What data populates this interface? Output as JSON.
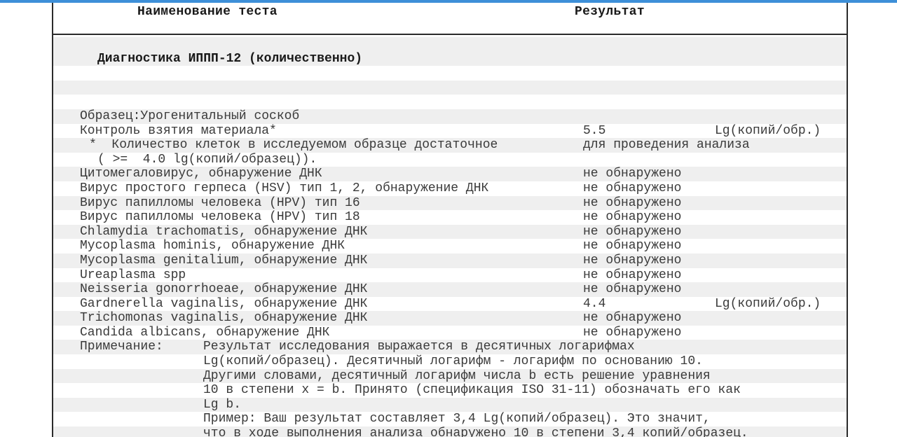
{
  "header": {
    "test_name": "Наименование теста",
    "result": "Результат"
  },
  "section_title": "Диагностика ИППП-12 (количественно)",
  "sample": "Образец:Урогенитальный соскоб",
  "control": {
    "name": "Контроль взятия материала*",
    "value": "5.5",
    "unit": "Lg(копий/обр.)"
  },
  "footnote": {
    "line1": "*  Количество клеток в исследуемом образце достаточное",
    "line1_right": "для проведения анализа",
    "line2": "( >=  4.0 lg(копий/образец))."
  },
  "tests": [
    {
      "name": "Цитомегаловирус, обнаружение ДНК",
      "result": "не обнаружено",
      "unit": ""
    },
    {
      "name": "Вирус простого герпеса (HSV) тип 1, 2, обнаружение ДНК",
      "result": "не обнаружено",
      "unit": ""
    },
    {
      "name": "Вирус папилломы человека (HPV) тип 16",
      "result": "не обнаружено",
      "unit": ""
    },
    {
      "name": "Вирус папилломы человека (HPV) тип 18",
      "result": "не обнаружено",
      "unit": ""
    },
    {
      "name": "Chlamydia trachomatis, обнаружение ДНК",
      "result": "не обнаружено",
      "unit": ""
    },
    {
      "name": "Mycoplasma hominis, обнаружение ДНК",
      "result": "не обнаружено",
      "unit": ""
    },
    {
      "name": "Mycoplasma genitalium, обнаружение ДНК",
      "result": "не обнаружено",
      "unit": ""
    },
    {
      "name": "Ureaplasma spp",
      "result": "не обнаружено",
      "unit": ""
    },
    {
      "name": "Neisseria gonorrhoeae, обнаружение ДНК",
      "result": "не обнаружено",
      "unit": ""
    },
    {
      "name": "Gardnerella vaginalis, обнаружение ДНК",
      "result": "4.4",
      "unit": "Lg(копий/обр.)"
    },
    {
      "name": "Trichomonas vaginalis, обнаружение ДНК",
      "result": "не обнаружено",
      "unit": ""
    },
    {
      "name": "Candida albicans, обнаружение ДНК",
      "result": "не обнаружено",
      "unit": ""
    }
  ],
  "note": {
    "label": "Примечание:",
    "lines": [
      "Результат исследования выражается в десятичных логарифмах",
      "Lg(копий/образец). Десятичный логарифм - логарифм по основанию 10.",
      "Другими словами, десятичный логарифм числа b есть решение уравнения",
      "10 в степени x = b. Принято (спецификация ISO 31-11) обозначать его как",
      "Lg b.",
      "Пример: Ваш результат составляет 3,4 Lg(копий/образец). Это значит,",
      "что в ходе выполнения анализа обнаружено 10 в степени 3,4 копий/образец."
    ]
  }
}
